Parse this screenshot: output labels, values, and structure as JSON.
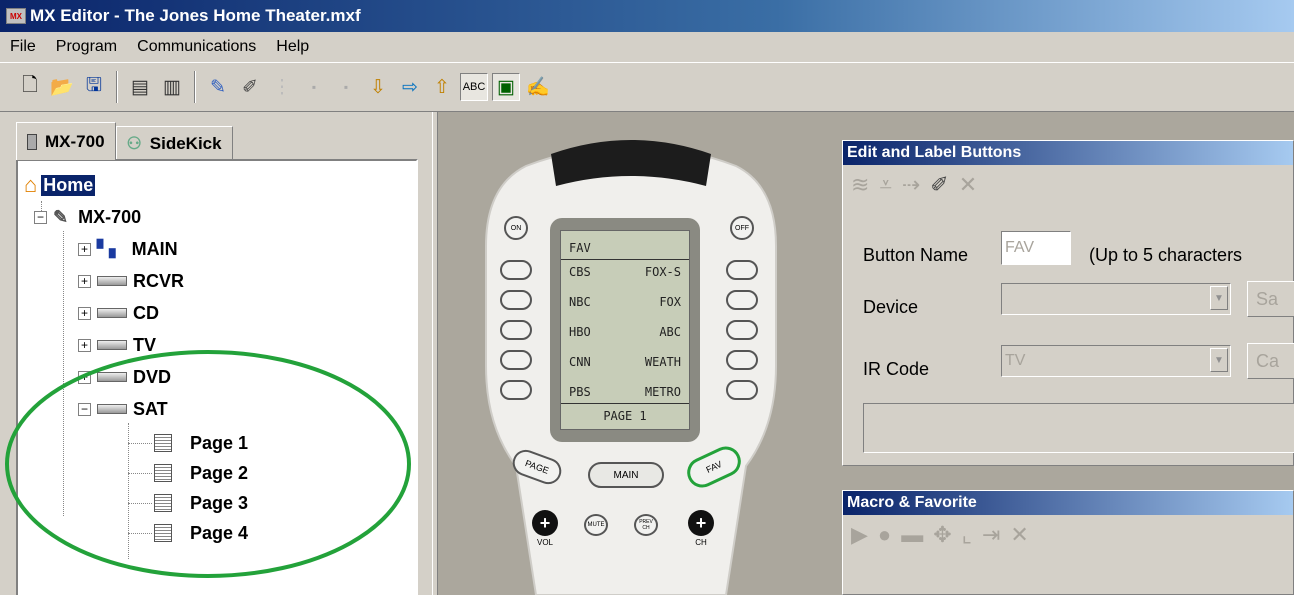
{
  "window": {
    "title": "MX Editor - The Jones Home Theater.mxf",
    "app_icon": "MX"
  },
  "menu": [
    "File",
    "Program",
    "Communications",
    "Help"
  ],
  "tabs": [
    "MX-700",
    "SideKick"
  ],
  "tree": {
    "home": "Home",
    "root": "MX-700",
    "devices": [
      "MAIN",
      "RCVR",
      "CD",
      "TV",
      "DVD",
      "SAT"
    ],
    "pages": [
      "Page 1",
      "Page 2",
      "Page 3",
      "Page 4"
    ]
  },
  "remote": {
    "on_label": "ON",
    "off_label": "OFF",
    "lcd_header": "FAV",
    "lcd_rows": [
      [
        "CBS",
        "FOX-S"
      ],
      [
        "NBC",
        "FOX"
      ],
      [
        "HBO",
        "ABC"
      ],
      [
        "CNN",
        "WEATH"
      ],
      [
        "PBS",
        "METRO"
      ]
    ],
    "lcd_footer": "PAGE 1",
    "page_btn": "PAGE",
    "main_btn": "MAIN",
    "fav_btn": "FAV",
    "vol_label": "VOL",
    "mute_label": "MUTE",
    "prev_label": "PREV CH",
    "ch_label": "CH"
  },
  "edit_panel": {
    "title": "Edit and Label Buttons",
    "button_name_label": "Button Name",
    "button_name_value": "FAV",
    "hint": "(Up to 5 characters",
    "device_label": "Device",
    "device_value": "",
    "device_btn": "Sa",
    "ir_label": "IR Code",
    "ir_value": "TV",
    "ir_btn": "Ca"
  },
  "macro_panel": {
    "title": "Macro & Favorite"
  },
  "colors": {
    "highlight": "#23a23a",
    "title_dark": "#0a246a",
    "title_light": "#a6caf0"
  }
}
